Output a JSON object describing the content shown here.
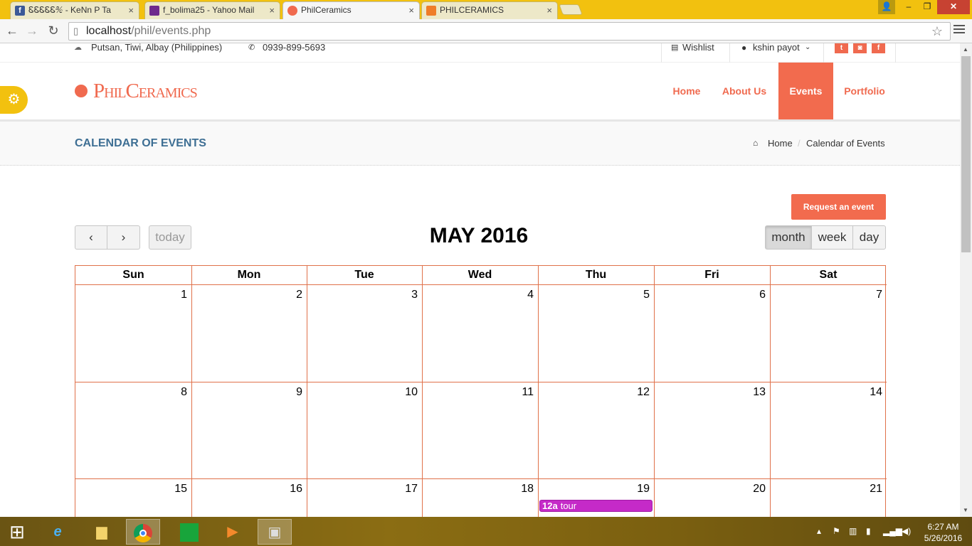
{
  "browser": {
    "tabs": [
      {
        "label": "ᏋᏋᏋᏋᏋ℀ - KeNn P Ta",
        "favicon_color": "#3b5998",
        "active": false
      },
      {
        "label": "f_bolima25 - Yahoo Mail",
        "favicon_color": "#6e2a8d",
        "active": false
      },
      {
        "label": "PhilCeramics",
        "favicon_color": "#f06a4f",
        "active": true
      },
      {
        "label": "PHILCERAMICS",
        "favicon_color": "#ef7d29",
        "active": false
      }
    ],
    "url_host": "localhost",
    "url_path": "/phil/events.php",
    "close_glyph": "×",
    "minimize_glyph": "‒",
    "restore_glyph": "❐",
    "window_close_glyph": "✕",
    "user_glyph": "👤"
  },
  "site": {
    "topbar": {
      "address": "Putsan, Tiwi, Albay (Philippines)",
      "phone": "0939-899-5693",
      "wishlist": "Wishlist",
      "user": "kshin payot",
      "social": [
        "twitter-icon",
        "instagram-icon",
        "facebook-icon"
      ]
    },
    "logo_text": "PhilCeramics",
    "nav": [
      "Home",
      "About Us",
      "Events",
      "Portfolio"
    ],
    "active_nav": "Events",
    "page_title": "CALENDAR OF EVENTS",
    "breadcrumb": {
      "home": "Home",
      "separator": "/",
      "current": "Calendar of Events"
    },
    "request_button": "Request an event"
  },
  "calendar": {
    "title": "MAY 2016",
    "today_button": "today",
    "views": [
      "month",
      "week",
      "day"
    ],
    "active_view": "month",
    "weekdays": [
      "Sun",
      "Mon",
      "Tue",
      "Wed",
      "Thu",
      "Fri",
      "Sat"
    ],
    "days": [
      1,
      2,
      3,
      4,
      5,
      6,
      7,
      8,
      9,
      10,
      11,
      12,
      13,
      14,
      15,
      16,
      17,
      18,
      19,
      20,
      21
    ],
    "events": [
      {
        "day": 19,
        "time": "12a",
        "title": "tour",
        "color": "#c52ac8"
      }
    ]
  },
  "taskbar": {
    "time": "6:27 AM",
    "date": "5/26/2016"
  }
}
